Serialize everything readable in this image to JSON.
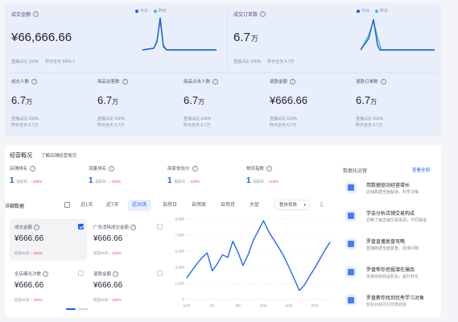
{
  "colors": {
    "accent": "#165dff",
    "today": "#1e5bd7",
    "yesterday": "#36c8c0",
    "up": "#f53f3f"
  },
  "top": {
    "gmv": {
      "label": "成交金额",
      "value": "¥66,666.66",
      "sub_1": "直播占比 100%",
      "sub_2": "昨日全天 6666.7",
      "legend_today": "今日",
      "legend_yesterday": "昨日"
    },
    "orders": {
      "label": "成交订单数",
      "value": "6.7",
      "unit": "万",
      "sub_1": "直播占比 100%",
      "sub_2": "昨日全天 6.7万",
      "legend_today": "今日",
      "legend_yesterday": "昨日"
    },
    "kpis": [
      {
        "label": "成交人数",
        "value": "6.7",
        "unit": "万",
        "sub_1": "直播占比 100%",
        "sub_2": "昨日全天 6.7万"
      },
      {
        "label": "商品访客数",
        "value": "6.7",
        "unit": "万",
        "sub_1": "直播占比 100%",
        "sub_2": "昨日全天 6.7万"
      },
      {
        "label": "商品点击人数",
        "value": "6.7",
        "unit": "万",
        "sub_1": "直播占比 100%",
        "sub_2": "昨日全天 6.7万"
      },
      {
        "label": "退款金额",
        "value": "¥666.66",
        "unit": "",
        "sub_1": "直播占比 100%",
        "sub_2": "昨日全天 6.7万"
      },
      {
        "label": "退款订单数",
        "value": "6.7",
        "unit": "万",
        "sub_1": "直播占比 100%",
        "sub_2": "昨日全天 6.7万"
      }
    ]
  },
  "overview": {
    "title": "经营概况",
    "link": "了解店铺经营情况",
    "stats": [
      {
        "label": "店铺排名",
        "value": "1",
        "cmp": "较前日",
        "delta": "↑ 100%"
      },
      {
        "label": "流量排名",
        "value": "1",
        "cmp": "较前日",
        "delta": "↑ 100%"
      },
      {
        "label": "商家体验分",
        "value": "1",
        "cmp": "较前日",
        "delta": "↑ 100%"
      },
      {
        "label": "物流指数",
        "value": "1",
        "cmp": "较前日",
        "delta": "↑ 100%"
      }
    ]
  },
  "detail": {
    "title": "详细数据",
    "tabs": [
      "近1天",
      "近7天",
      "近30天",
      "自然日",
      "自然周",
      "自然月",
      "大促"
    ],
    "active_tab": "近30天",
    "select": "整体视角",
    "cards": [
      {
        "label": "成交金额",
        "value": "¥666.66",
        "cmp": "较前30天",
        "delta": "↑ 100%",
        "checked": true
      },
      {
        "label": "广告消耗成交金额",
        "value": "¥666.66",
        "cmp": "较前30天",
        "delta": "↑ 100%",
        "checked": false
      },
      {
        "label": "全店曝光次数",
        "value": "¥666.66",
        "cmp": "较前30天",
        "delta": "↑ 100%",
        "checked": false
      },
      {
        "label": "退款金额",
        "value": "¥666.66",
        "cmp": "较前30天",
        "delta": "↑ 100%",
        "checked": false
      }
    ]
  },
  "chart_data": {
    "type": "line",
    "x": [
      "1/27",
      "1/28",
      "1/29",
      "1/30",
      "1/31",
      "2/1",
      "2/2",
      "2/3",
      "2/4",
      "2/5",
      "2/6",
      "2/7",
      "2/8",
      "2/9",
      "2/10",
      "2/11",
      "2/12",
      "2/13",
      "2/14",
      "2/15",
      "2/16",
      "2/17",
      "2/18",
      "2/19",
      "2/20",
      "2/21",
      "2/22",
      "2/23",
      "2/24"
    ],
    "x_tick_labels": [
      "1/27",
      "2/1",
      "2/6",
      "2/11",
      "2/16",
      "2/21"
    ],
    "y_tick_labels": [
      "9,000",
      "7,000",
      "5,000",
      "3,000",
      "1,000",
      "0"
    ],
    "ylim": [
      0,
      9000
    ],
    "series": [
      {
        "values": [
          2400,
          3200,
          4000,
          4700,
          5200,
          3200,
          4000,
          5000,
          4700,
          6500,
          5300,
          3800,
          5000,
          6600,
          7700,
          8800,
          7600,
          6700,
          5800,
          4800,
          3600,
          2300,
          1000,
          1600,
          2600,
          3500,
          4500,
          5500,
          6400
        ]
      }
    ],
    "grid": true
  },
  "side": {
    "title": "数据化运营",
    "more": "查看全部",
    "items": [
      {
        "title": "用数据驱动经营增长",
        "desc": "店铺数据全面解读，科学决策"
      },
      {
        "title": "学会分析店铺交易构成",
        "desc": "洞察了解店铺交易来源，不同渠道"
      },
      {
        "title": "罗盘直播复盘攻略",
        "desc": "直播数据全面复盘，找准问题"
      },
      {
        "title": "罗盘帮你挖掘潜在爆品",
        "desc": "快速找到商品机会，提升转化"
      },
      {
        "title": "罗盘教你找到优秀学习对象",
        "desc": "轻松对标同行优秀商家"
      }
    ]
  }
}
